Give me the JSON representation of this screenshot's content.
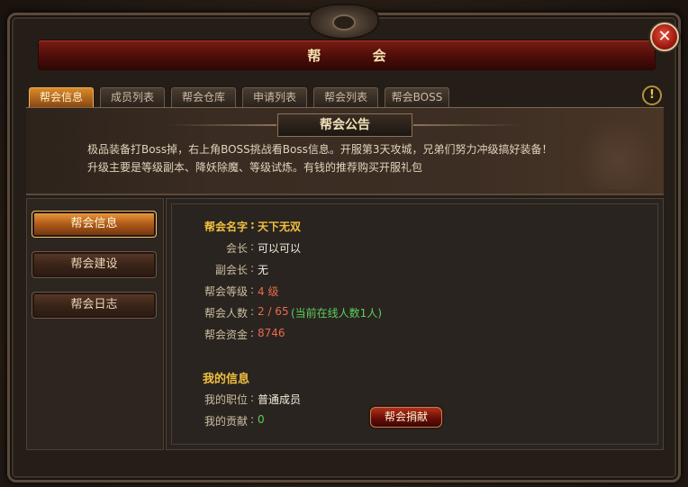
{
  "window": {
    "title": "帮 会"
  },
  "tabs": [
    {
      "label": "帮会信息",
      "active": true
    },
    {
      "label": "成员列表"
    },
    {
      "label": "帮会仓库"
    },
    {
      "label": "申请列表"
    },
    {
      "label": "帮会列表"
    },
    {
      "label": "帮会BOSS"
    }
  ],
  "notice": {
    "header": "帮会公告",
    "lines": [
      "极品装备打Boss掉，右上角BOSS挑战看Boss信息。开服第3天攻城，兄弟们努力冲级搞好装备！",
      "升级主要是等级副本、降妖除魔、等级试炼。有钱的推荐购买开服礼包"
    ]
  },
  "sidebar": {
    "items": [
      {
        "label": "帮会信息",
        "active": true
      },
      {
        "label": "帮会建设"
      },
      {
        "label": "帮会日志"
      }
    ]
  },
  "guild_info": {
    "name_label": "帮会名字",
    "name": "天下无双",
    "leader_label": "会长",
    "leader": "可以可以",
    "vice_label": "副会长",
    "vice": "无",
    "level_label": "帮会等级",
    "level": "4 级",
    "members_label": "帮会人数",
    "members": "2 / 65",
    "online": "(当前在线人数1人)",
    "funds_label": "帮会资金",
    "funds": "8746"
  },
  "my_info": {
    "title": "我的信息",
    "position_label": "我的职位",
    "position": "普通成员",
    "contribution_label": "我的贡献",
    "contribution": "0",
    "donate_label": "帮会捐献"
  },
  "colors": {
    "gold": "#f0c040",
    "red_value": "#e86a4a",
    "green_value": "#5ad05a",
    "active_tab": "#d98a2c"
  },
  "icons": {
    "close": "close-icon",
    "help": "exclamation-icon"
  }
}
